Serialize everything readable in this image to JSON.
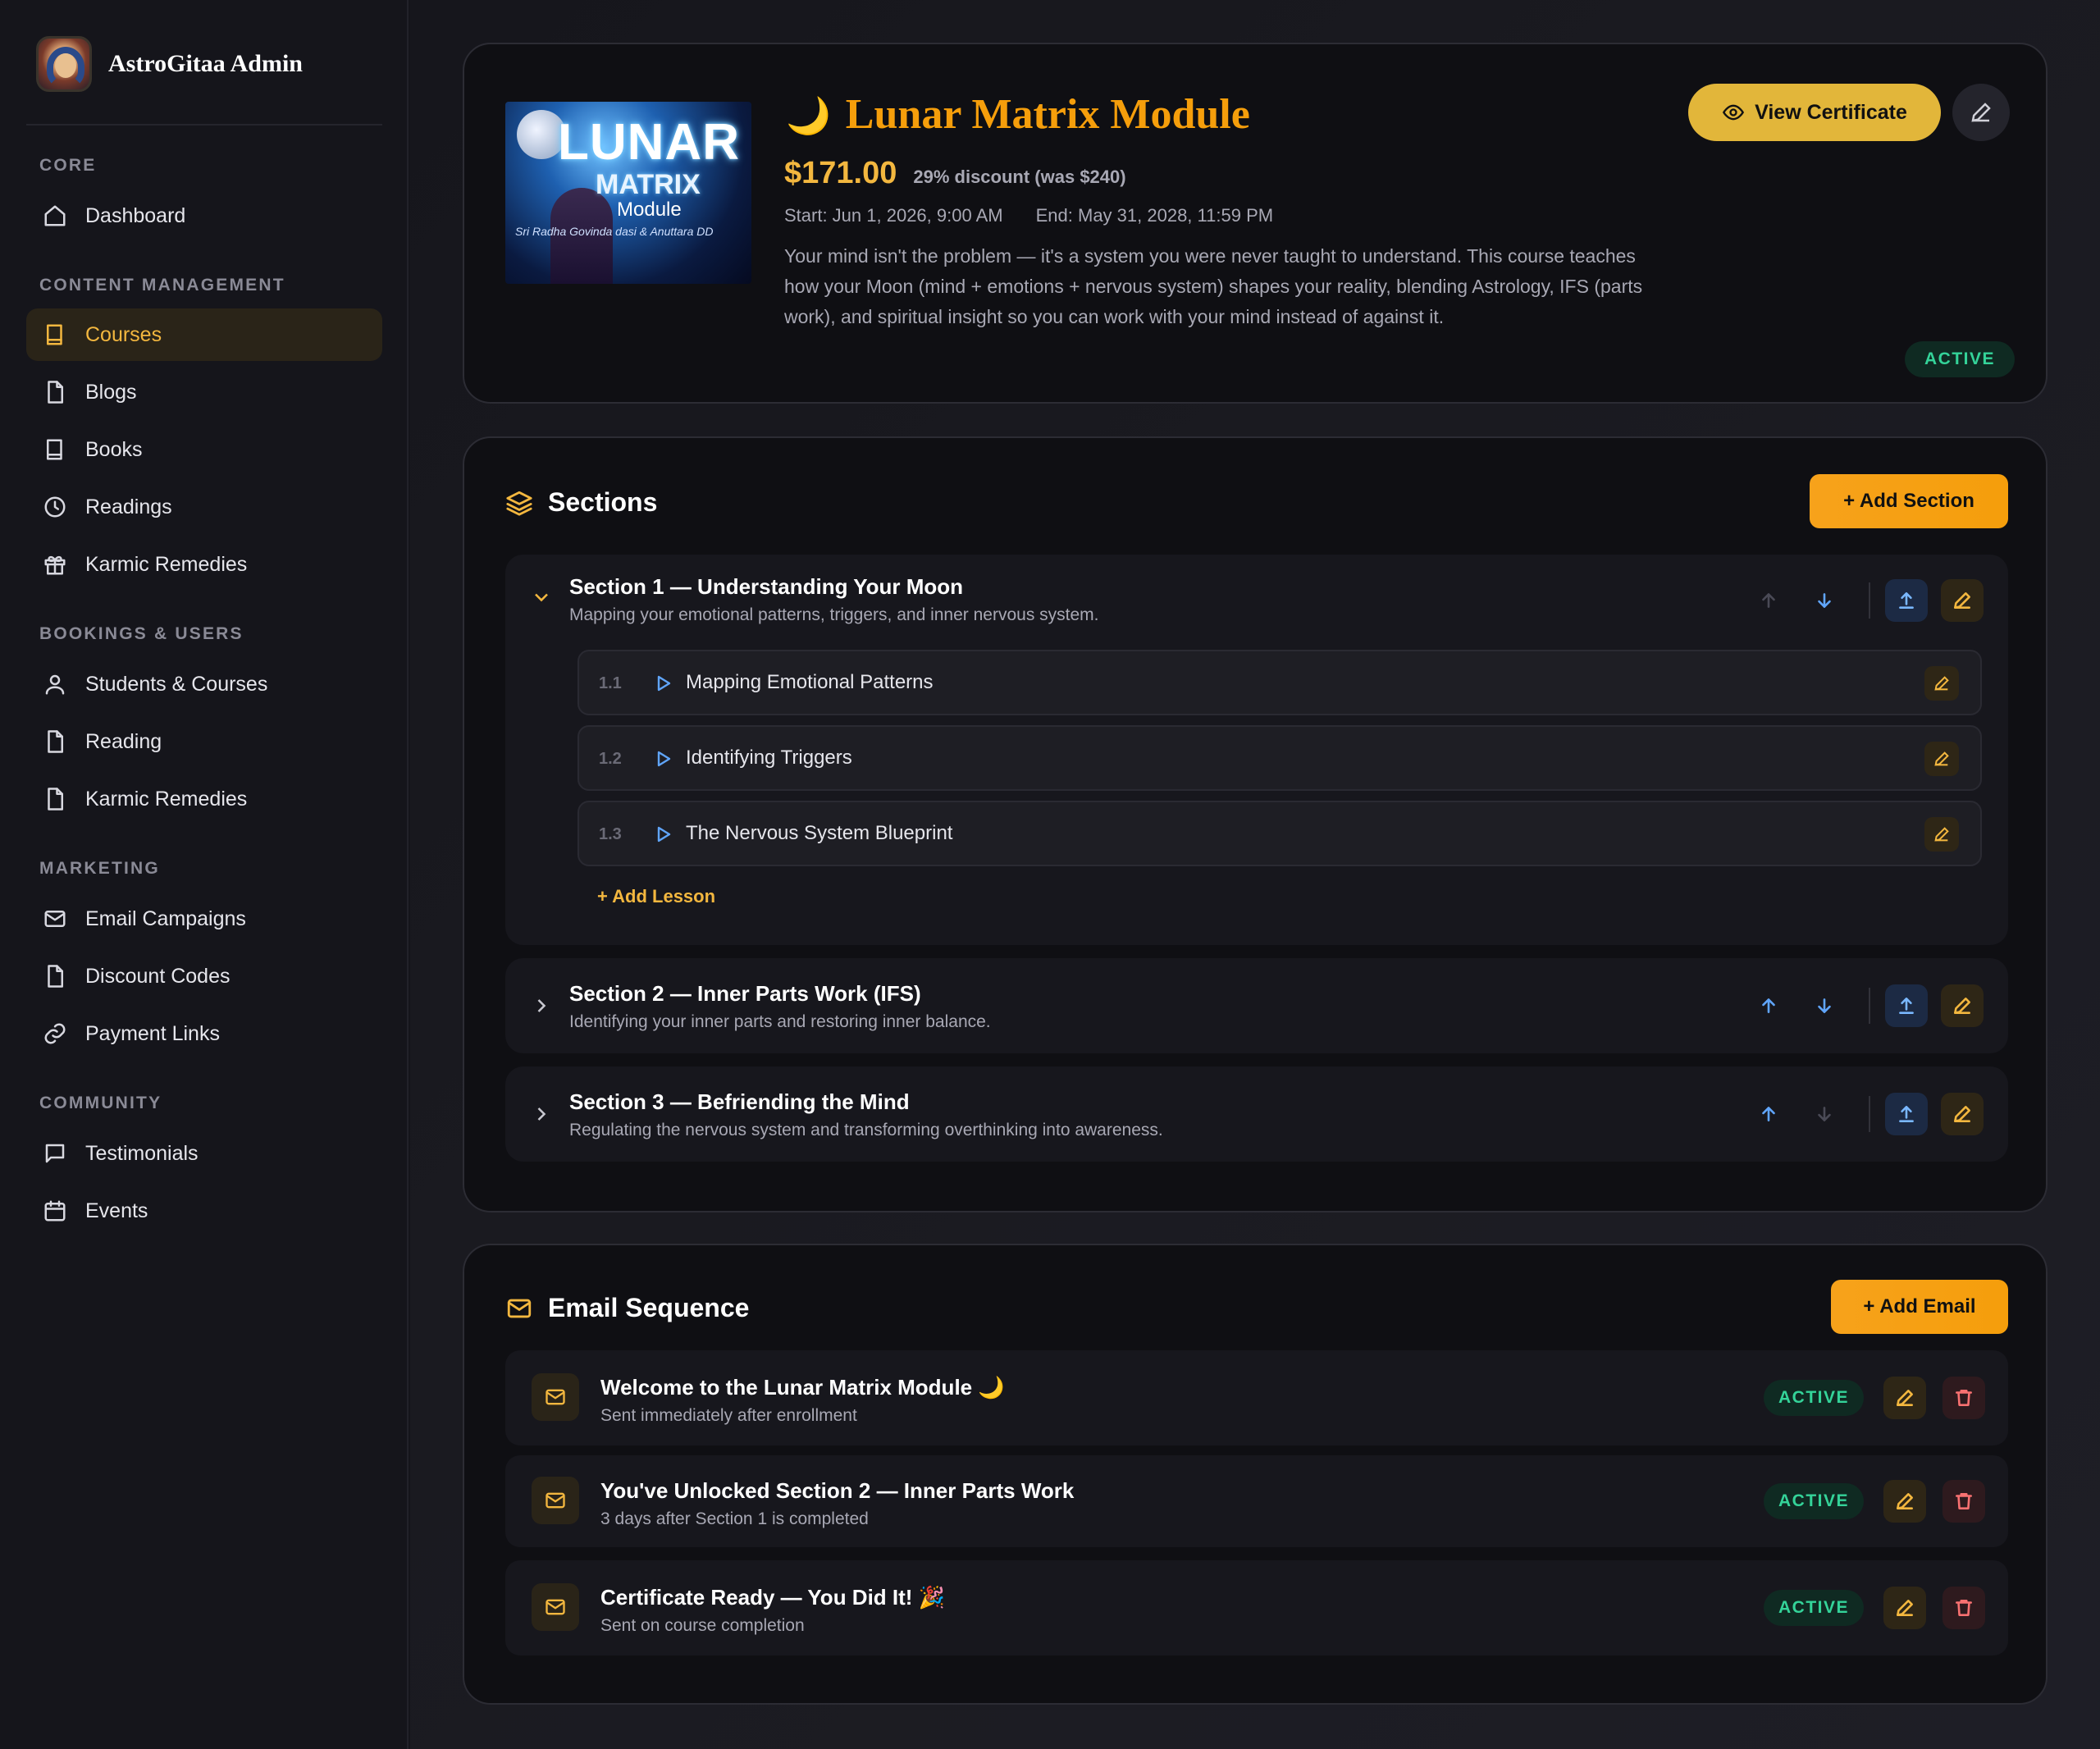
{
  "sidebar": {
    "brand": "AstroGitaa Admin",
    "groups": [
      {
        "heading": "CORE",
        "items": [
          {
            "label": "Dashboard",
            "icon": "home-icon"
          }
        ]
      },
      {
        "heading": "CONTENT MANAGEMENT",
        "items": [
          {
            "label": "Courses",
            "icon": "book-icon",
            "active": true
          },
          {
            "label": "Blogs",
            "icon": "file-icon"
          },
          {
            "label": "Books",
            "icon": "book-icon"
          },
          {
            "label": "Readings",
            "icon": "clock-icon"
          },
          {
            "label": "Karmic Remedies",
            "icon": "gift-icon"
          }
        ]
      },
      {
        "heading": "BOOKINGS & USERS",
        "items": [
          {
            "label": "Students & Courses",
            "icon": "user-icon"
          },
          {
            "label": "Reading",
            "icon": "file-icon"
          },
          {
            "label": "Karmic Remedies",
            "icon": "file-icon"
          }
        ]
      },
      {
        "heading": "MARKETING",
        "items": [
          {
            "label": "Email Campaigns",
            "icon": "mail-icon"
          },
          {
            "label": "Discount Codes",
            "icon": "file-icon"
          },
          {
            "label": "Payment Links",
            "icon": "link-icon"
          }
        ]
      },
      {
        "heading": "COMMUNITY",
        "items": [
          {
            "label": "Testimonials",
            "icon": "message-icon"
          },
          {
            "label": "Events",
            "icon": "calendar-icon"
          }
        ]
      }
    ]
  },
  "course": {
    "thumbnail": {
      "line1": "LUNAR",
      "line2": "MATRIX",
      "line3": "Module",
      "credit": "Sri Radha Govinda dasi & Anuttara DD"
    },
    "title_icon": "🌙",
    "title": "Lunar Matrix Module",
    "price": "$171.00",
    "discount": "29% discount (was $240)",
    "start": "Start: Jun 1, 2026, 9:00 AM",
    "end": "End: May 31, 2028, 11:59 PM",
    "description": "Your mind isn't the problem — it's a system you were never taught to understand. This course teaches how your Moon (mind + emotions + nervous system) shapes your reality, blending Astrology, IFS (parts work), and spiritual insight so you can work with your mind instead of against it.",
    "view_certificate_label": "View Certificate",
    "status": "ACTIVE"
  },
  "sections_card": {
    "title": "Sections",
    "add_label": "+ Add Section",
    "sections": [
      {
        "title": "Section 1 — Understanding Your Moon",
        "subtitle": "Mapping your emotional patterns, triggers, and inner nervous system.",
        "expanded": true,
        "lessons": [
          {
            "num": "1.1",
            "title": "Mapping Emotional Patterns"
          },
          {
            "num": "1.2",
            "title": "Identifying Triggers"
          },
          {
            "num": "1.3",
            "title": "The Nervous System Blueprint"
          }
        ],
        "add_lesson_label": "+ Add Lesson"
      },
      {
        "title": "Section 2 — Inner Parts Work (IFS)",
        "subtitle": "Identifying your inner parts and restoring inner balance."
      },
      {
        "title": "Section 3 — Befriending the Mind",
        "subtitle": "Regulating the nervous system and transforming overthinking into awareness."
      }
    ]
  },
  "email_card": {
    "title": "Email Sequence",
    "add_label": "+ Add Email",
    "emails": [
      {
        "title": "Welcome to the Lunar Matrix Module 🌙",
        "subtitle": "Sent immediately after enrollment",
        "status": "ACTIVE"
      },
      {
        "title": "You've Unlocked Section 2 — Inner Parts Work",
        "subtitle": "3 days after Section 1 is completed",
        "status": "ACTIVE"
      },
      {
        "title": "Certificate Ready — You Did It! 🎉",
        "subtitle": "Sent on course completion",
        "status": "ACTIVE"
      }
    ]
  },
  "colors": {
    "accent": "#f3b73f",
    "orange": "#f59e0b",
    "active_green": "#34d399",
    "arrow_blue": "#60a5fa"
  }
}
